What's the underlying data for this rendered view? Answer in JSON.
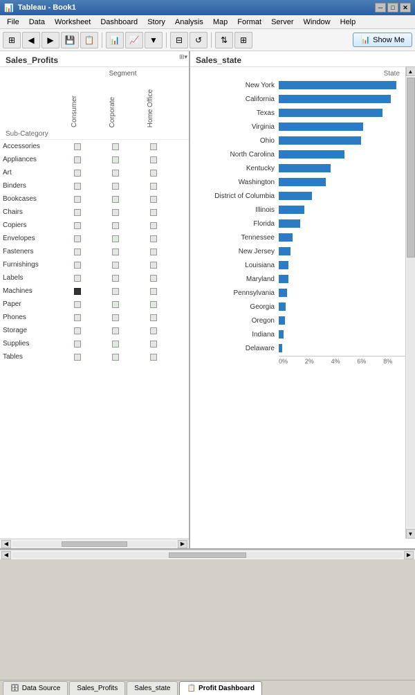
{
  "titleBar": {
    "title": "Tableau - Book1",
    "minBtn": "─",
    "maxBtn": "□",
    "closeBtn": "✕"
  },
  "menuBar": {
    "items": [
      "File",
      "Data",
      "Worksheet",
      "Dashboard",
      "Story",
      "Analysis",
      "Map",
      "Format",
      "Server",
      "Window",
      "Help"
    ]
  },
  "toolbar": {
    "showMeLabel": "Show Me",
    "showMeIcon": "📊"
  },
  "leftPanel": {
    "title": "Sales_Profits",
    "segmentHeader": "Segment",
    "columns": [
      "Consumer",
      "Corporate",
      "Home Office"
    ],
    "subCategoryLabel": "Sub-Category",
    "rows": [
      "Accessories",
      "Appliances",
      "Art",
      "Binders",
      "Bookcases",
      "Chairs",
      "Copiers",
      "Envelopes",
      "Fasteners",
      "Furnishings",
      "Labels",
      "Machines",
      "Paper",
      "Phones",
      "Storage",
      "Supplies",
      "Tables"
    ],
    "machinesDark": true
  },
  "rightPanel": {
    "title": "Sales_state",
    "stateHeader": "State",
    "bars": [
      {
        "state": "New York",
        "pct": 100
      },
      {
        "state": "California",
        "pct": 95
      },
      {
        "state": "Texas",
        "pct": 88
      },
      {
        "state": "Virginia",
        "pct": 72
      },
      {
        "state": "Ohio",
        "pct": 70
      },
      {
        "state": "North Carolina",
        "pct": 56
      },
      {
        "state": "Kentucky",
        "pct": 44
      },
      {
        "state": "Washington",
        "pct": 40
      },
      {
        "state": "District of Columbia",
        "pct": 28
      },
      {
        "state": "Illinois",
        "pct": 22
      },
      {
        "state": "Florida",
        "pct": 18
      },
      {
        "state": "Tennessee",
        "pct": 12
      },
      {
        "state": "New Jersey",
        "pct": 10
      },
      {
        "state": "Louisiana",
        "pct": 8
      },
      {
        "state": "Maryland",
        "pct": 8
      },
      {
        "state": "Pennsylvania",
        "pct": 7
      },
      {
        "state": "Georgia",
        "pct": 6
      },
      {
        "state": "Oregon",
        "pct": 5
      },
      {
        "state": "Indiana",
        "pct": 4
      },
      {
        "state": "Delaware",
        "pct": 3
      }
    ],
    "axisLabels": [
      "0%",
      "2%",
      "4%",
      "6%",
      "8%"
    ]
  },
  "tabs": [
    {
      "label": "Data Source",
      "icon": "🗄",
      "active": false
    },
    {
      "label": "Sales_Profits",
      "icon": "",
      "active": false
    },
    {
      "label": "Sales_state",
      "icon": "",
      "active": false
    },
    {
      "label": "Profit Dashboard",
      "icon": "📋",
      "active": true
    }
  ]
}
